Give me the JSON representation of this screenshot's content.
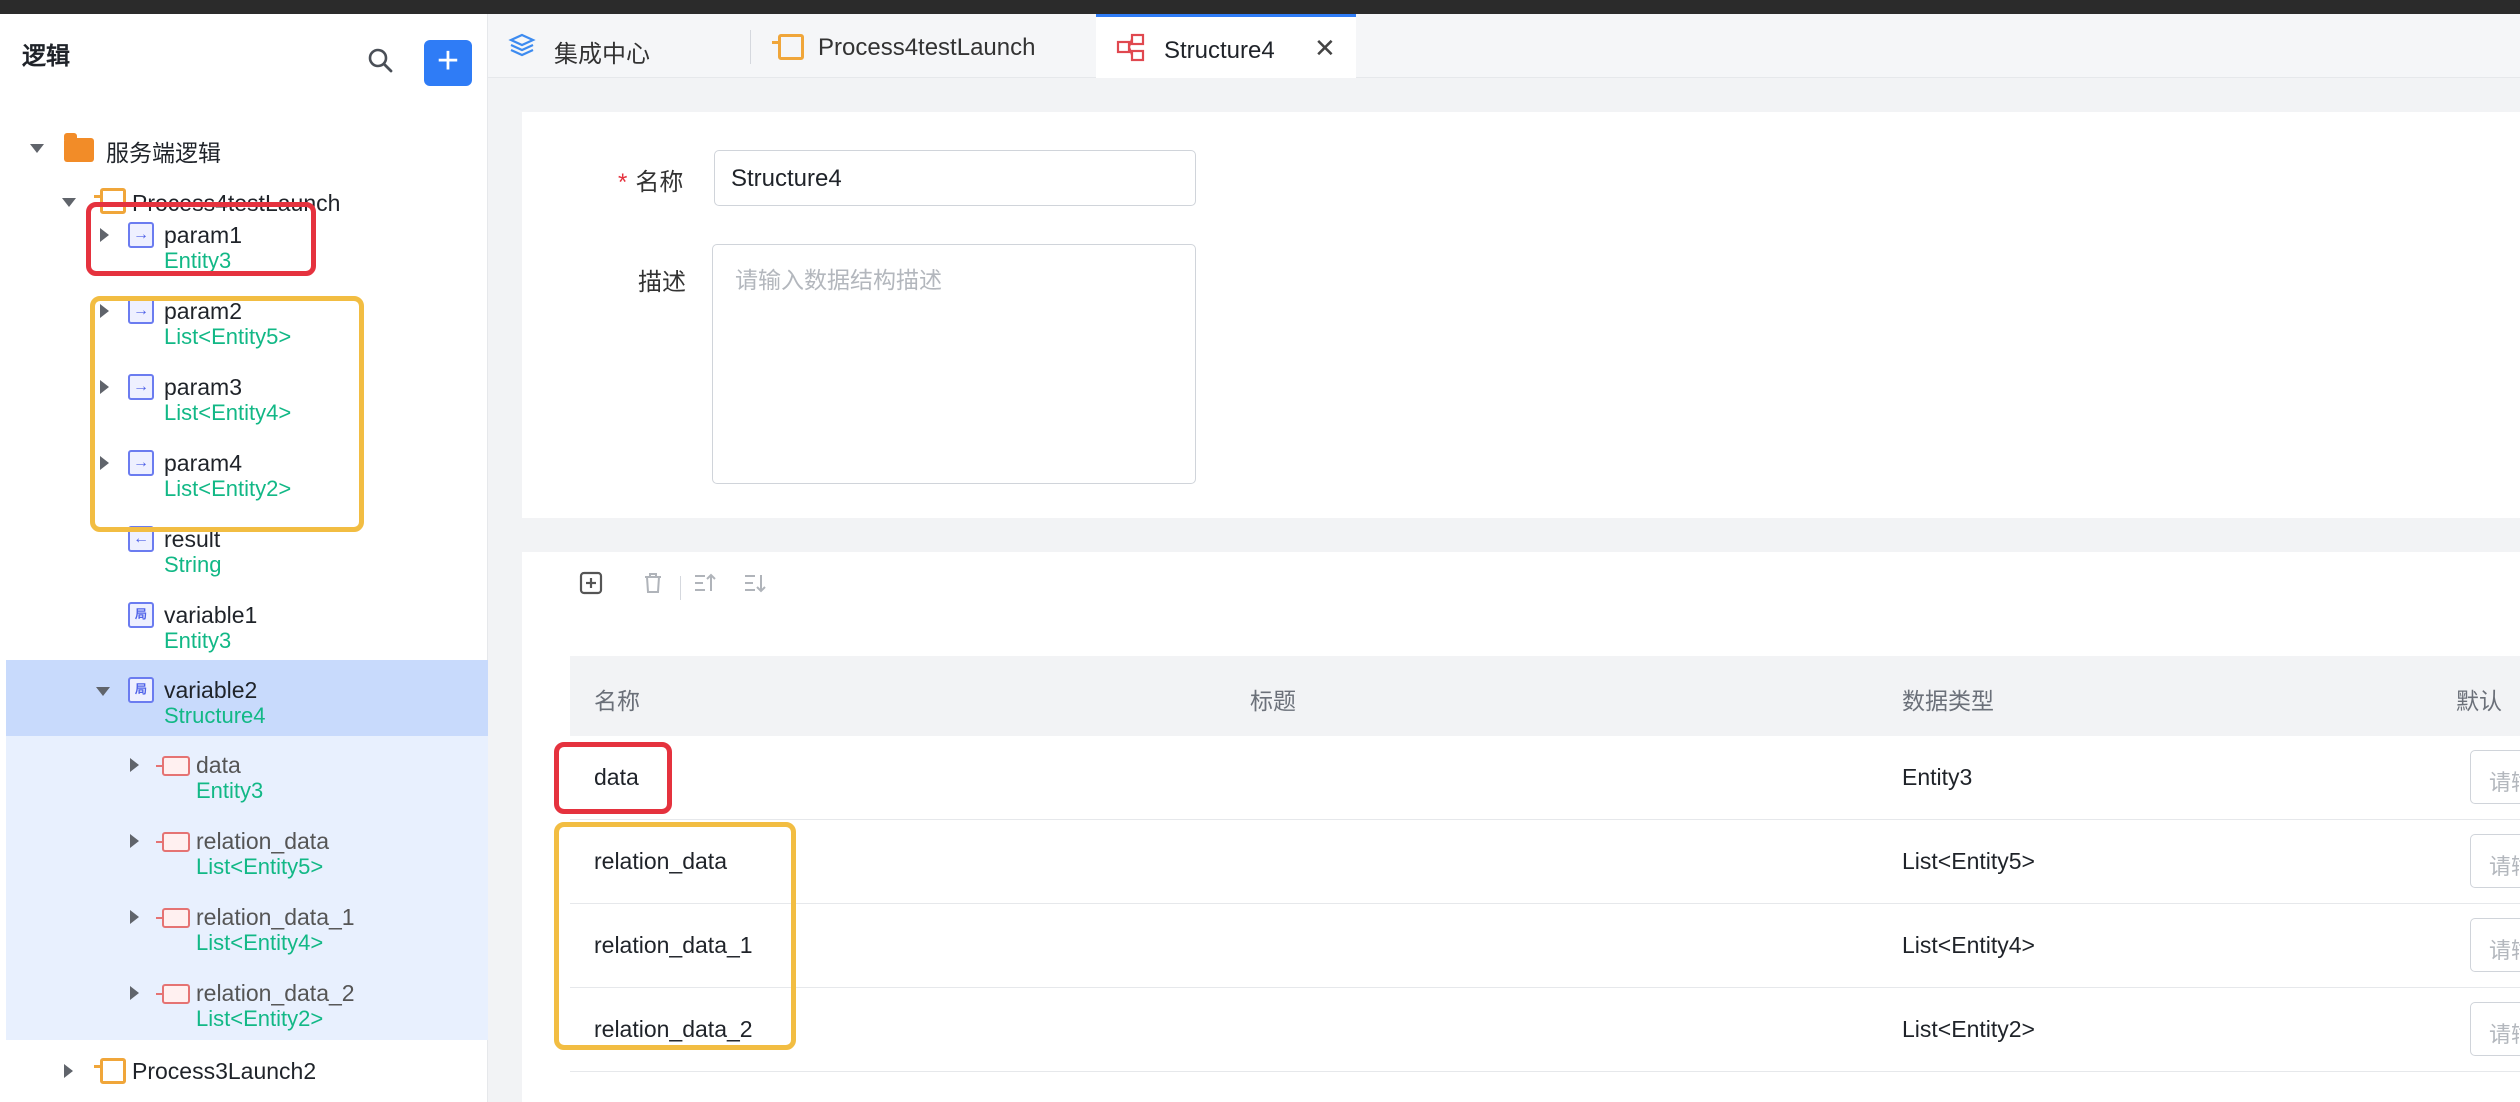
{
  "sidebar": {
    "title": "逻辑",
    "add_label": "+",
    "tree": {
      "root": "服务端逻辑",
      "process1": "Process4testLaunch",
      "items": [
        {
          "name": "param1",
          "type": "Entity3"
        },
        {
          "name": "param2",
          "type": "List<Entity5>"
        },
        {
          "name": "param3",
          "type": "List<Entity4>"
        },
        {
          "name": "param4",
          "type": "List<Entity2>"
        },
        {
          "name": "result",
          "type": "String"
        },
        {
          "name": "variable1",
          "type": "Entity3"
        },
        {
          "name": "variable2",
          "type": "Structure4"
        }
      ],
      "children": [
        {
          "name": "data",
          "type": "Entity3"
        },
        {
          "name": "relation_data",
          "type": "List<Entity5>"
        },
        {
          "name": "relation_data_1",
          "type": "List<Entity4>"
        },
        {
          "name": "relation_data_2",
          "type": "List<Entity2>"
        }
      ],
      "process2": "Process3Launch2",
      "var_icon_glyph": "局"
    }
  },
  "tabs": [
    {
      "label": "集成中心",
      "active": false
    },
    {
      "label": "Process4testLaunch",
      "active": false
    },
    {
      "label": "Structure4",
      "active": true
    }
  ],
  "tab_close": "✕",
  "form": {
    "name_label": "名称",
    "required_mark": "*",
    "name_value": "Structure4",
    "desc_label": "描述",
    "desc_placeholder": "请输入数据结构描述"
  },
  "table": {
    "headers": [
      "名称",
      "标题",
      "数据类型",
      "默认"
    ],
    "rows": [
      {
        "name": "data",
        "title": "",
        "type": "Entity3",
        "default_placeholder": "请输"
      },
      {
        "name": "relation_data",
        "title": "",
        "type": "List<Entity5>",
        "default_placeholder": "请输"
      },
      {
        "name": "relation_data_1",
        "title": "",
        "type": "List<Entity4>",
        "default_placeholder": "请输"
      },
      {
        "name": "relation_data_2",
        "title": "",
        "type": "List<Entity2>",
        "default_placeholder": "请输"
      }
    ]
  },
  "colors": {
    "accent": "#2f7cf6",
    "type_text": "#12b886",
    "highlight_red": "#e5323e",
    "highlight_yellow": "#f2bd42",
    "selected_row": "#c8dafc"
  }
}
